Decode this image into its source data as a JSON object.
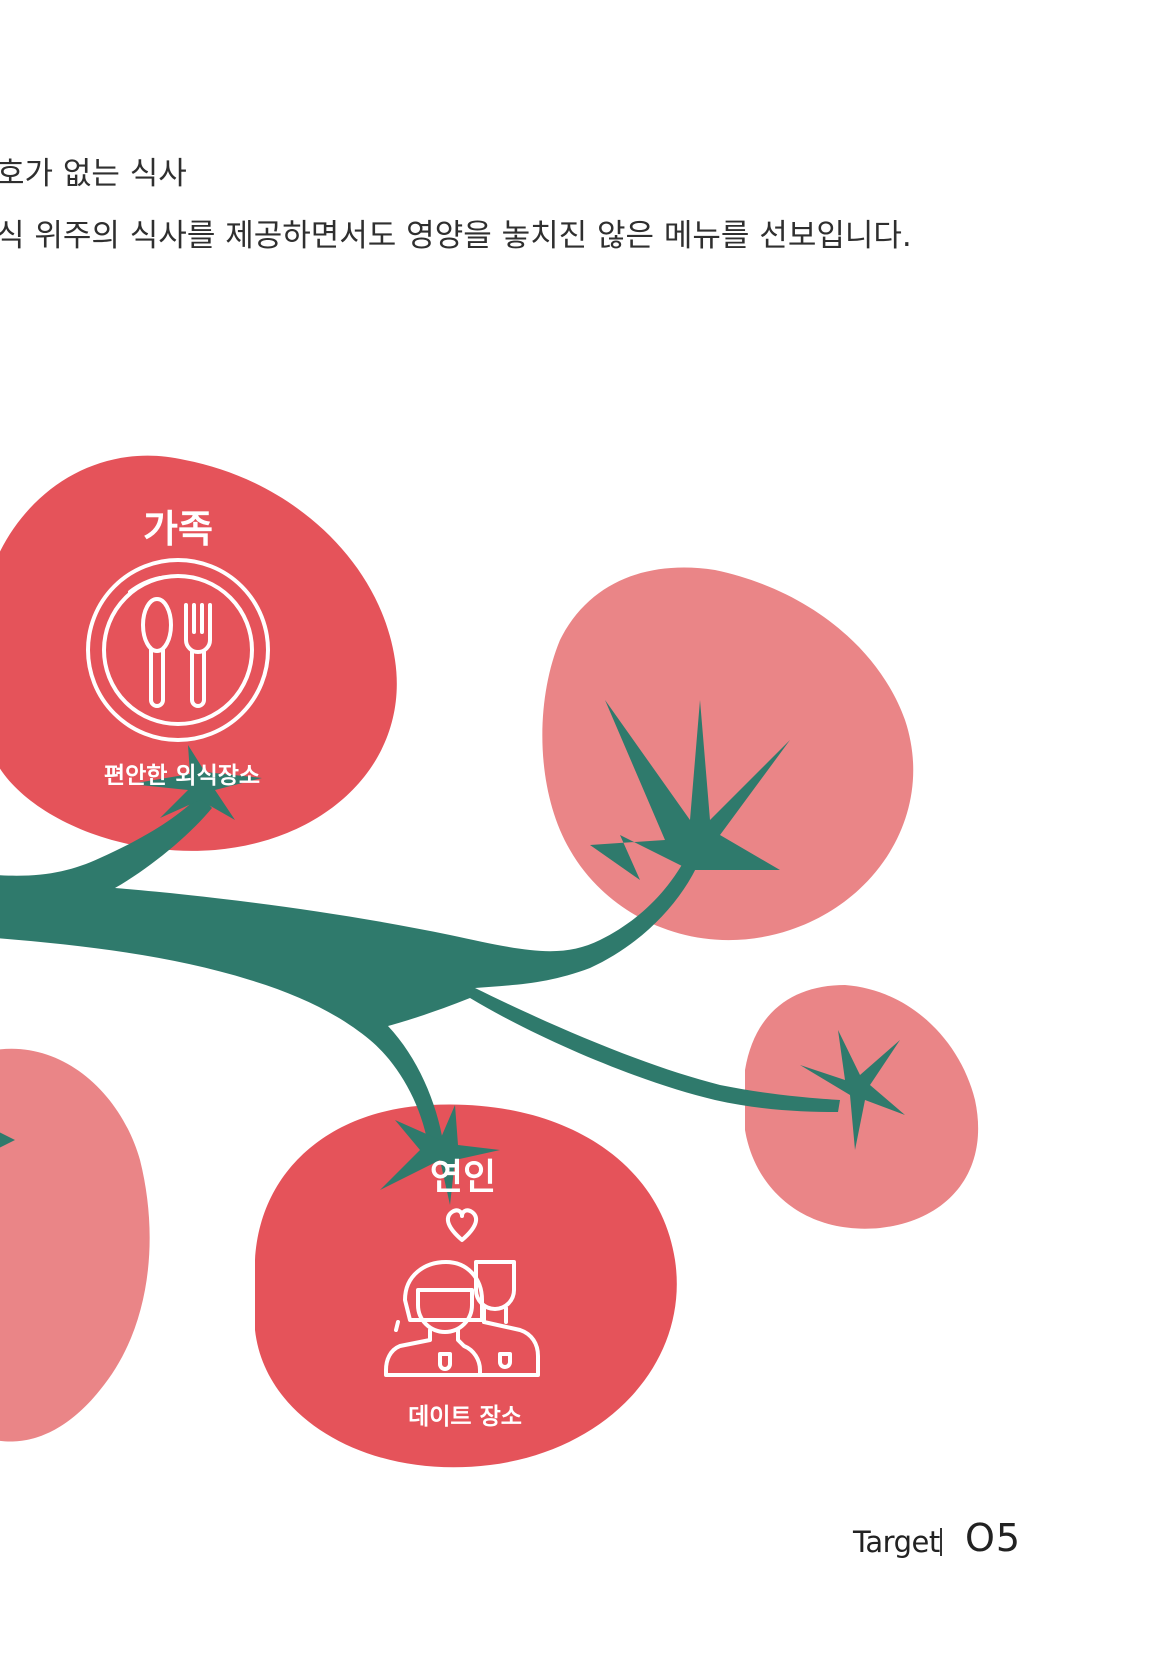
{
  "text": {
    "line1": "호가 없는 식사",
    "line2": "식 위주의 식사를 제공하면서도 영양을 놓치진 않은 메뉴를 선보입니다."
  },
  "groups": [
    {
      "title": "가족",
      "subtitle": "편안한 외식장소",
      "icon": "plate-spoon-fork-icon"
    },
    {
      "title": "연인",
      "subtitle": "데이트 장소",
      "icon": "couple-heart-icon"
    }
  ],
  "footer": {
    "label": "Target",
    "page": "O5"
  },
  "colors": {
    "tomato_dark": "#e5535a",
    "tomato_light": "#ea8587",
    "stem": "#2f7a6c",
    "text": "#2f2f2f"
  }
}
